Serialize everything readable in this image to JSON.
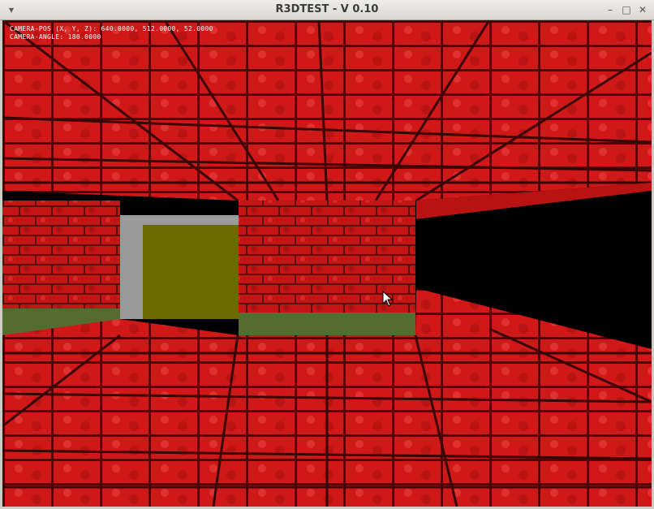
{
  "window": {
    "title": "R3DTEST - V 0.10",
    "menu_icon": "window-menu-icon",
    "minimize_icon": "minimize-icon",
    "maximize_icon": "maximize-icon",
    "close_icon": "close-icon"
  },
  "hud": {
    "camera_pos": "CAMERA-POS (X, Y, Z): 640.0000, 512.0000, 52.0000",
    "camera_angle": "CAMERA-ANGLE: 180.0000"
  },
  "scene": {
    "wall_color": "#c41414",
    "grass_color": "#556b2f",
    "door_color": "#6b6b00",
    "door_frame_color": "#9a9a9a",
    "void_color": "#000000"
  }
}
